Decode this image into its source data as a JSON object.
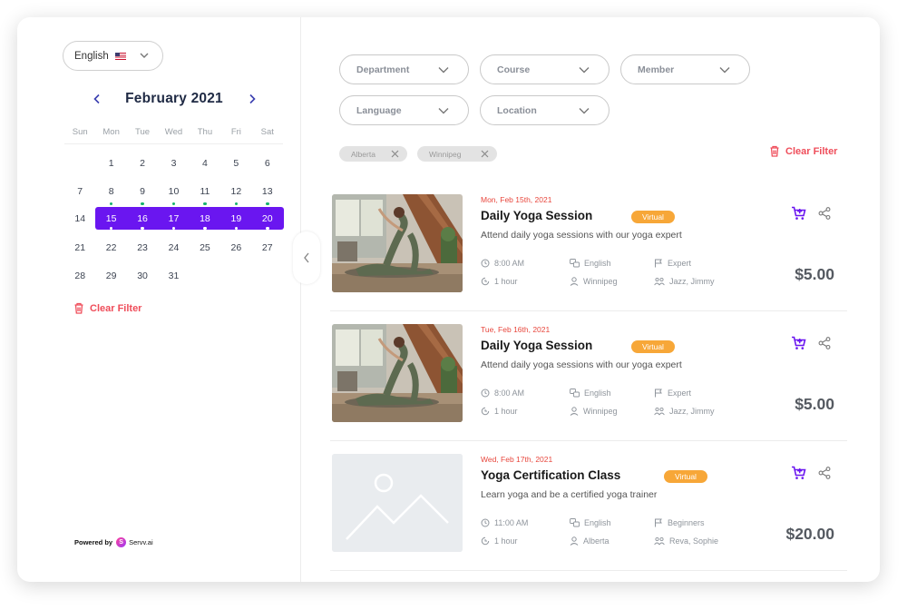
{
  "sidebar": {
    "language": "English",
    "calendar": {
      "title": "February 2021",
      "weekdays": [
        "Sun",
        "Mon",
        "Tue",
        "Wed",
        "Thu",
        "Fri",
        "Sat"
      ],
      "weeks": [
        [
          {
            "d": ""
          },
          {
            "d": "1"
          },
          {
            "d": "2"
          },
          {
            "d": "3"
          },
          {
            "d": "4"
          },
          {
            "d": "5"
          },
          {
            "d": "6"
          }
        ],
        [
          {
            "d": "7"
          },
          {
            "d": "8",
            "dot": true
          },
          {
            "d": "9",
            "dot": true
          },
          {
            "d": "10",
            "dot": true
          },
          {
            "d": "11",
            "dot": true
          },
          {
            "d": "12",
            "dot": true
          },
          {
            "d": "13",
            "dot": true
          }
        ],
        [
          {
            "d": "14"
          },
          {
            "d": "15",
            "dot": true,
            "sel": true
          },
          {
            "d": "16",
            "dot": true,
            "sel": true
          },
          {
            "d": "17",
            "dot": true,
            "sel": true
          },
          {
            "d": "18",
            "dot": true,
            "sel": true
          },
          {
            "d": "19",
            "dot": true,
            "sel": true
          },
          {
            "d": "20",
            "dot": true,
            "sel": true
          }
        ],
        [
          {
            "d": "21"
          },
          {
            "d": "22"
          },
          {
            "d": "23"
          },
          {
            "d": "24"
          },
          {
            "d": "25"
          },
          {
            "d": "26"
          },
          {
            "d": "27"
          }
        ],
        [
          {
            "d": "28"
          },
          {
            "d": "29"
          },
          {
            "d": "30"
          },
          {
            "d": "31"
          },
          {
            "d": ""
          },
          {
            "d": ""
          },
          {
            "d": ""
          }
        ]
      ]
    },
    "clear_filter": "Clear Filter",
    "powered_by": "Powered by",
    "brand": "Servv.ai",
    "brand_letter": "S"
  },
  "filters": {
    "department": "Department",
    "course": "Course",
    "member": "Member",
    "language": "Language",
    "location": "Location"
  },
  "chips": [
    "Alberta",
    "Winnipeg"
  ],
  "clear_filter": "Clear Filter",
  "colors": {
    "accent": "#6a16f0",
    "danger": "#ef4d5a",
    "badge": "#f7a738",
    "dot": "#18b56d"
  },
  "events": [
    {
      "date": "Mon, Feb 15th, 2021",
      "title": "Daily Yoga Session",
      "badge": "Virtual",
      "description": "Attend daily yoga sessions with our yoga expert",
      "time": "8:00 AM",
      "language": "English",
      "level": "Expert",
      "duration": "1 hour",
      "location": "Winnipeg",
      "instructors": "Jazz, Jimmy",
      "price": "$5.00",
      "image": "yoga"
    },
    {
      "date": "Tue, Feb 16th, 2021",
      "title": "Daily Yoga Session",
      "badge": "Virtual",
      "description": "Attend daily yoga sessions with our yoga expert",
      "time": "8:00 AM",
      "language": "English",
      "level": "Expert",
      "duration": "1 hour",
      "location": "Winnipeg",
      "instructors": "Jazz, Jimmy",
      "price": "$5.00",
      "image": "yoga"
    },
    {
      "date": "Wed, Feb 17th, 2021",
      "title": "Yoga Certification Class",
      "badge": "Virtual",
      "description": "Learn yoga and be a certified yoga trainer",
      "time": "11:00 AM",
      "language": "English",
      "level": "Beginners",
      "duration": "1 hour",
      "location": "Alberta",
      "instructors": "Reva, Sophie",
      "price": "$20.00",
      "image": "placeholder"
    }
  ]
}
